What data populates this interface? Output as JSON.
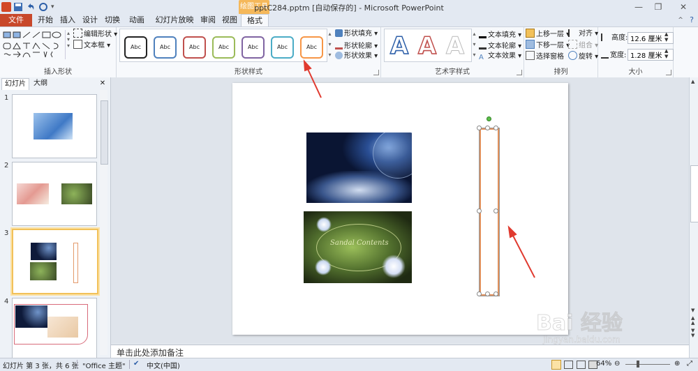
{
  "window": {
    "title": "pptC284.pptm [自动保存的] - Microsoft PowerPoint",
    "context_tab": "绘图工具"
  },
  "tabs": [
    "文件",
    "开始",
    "插入",
    "设计",
    "切换",
    "动画",
    "幻灯片放映",
    "审阅",
    "视图",
    "格式"
  ],
  "ribbon": {
    "insert_shapes": {
      "edit_shape": "编辑形状",
      "text_box": "文本框",
      "label": "插入形状"
    },
    "shape_styles": {
      "sample": "Abc",
      "fill": "形状填充",
      "outline": "形状轮廓",
      "effects": "形状效果",
      "label": "形状样式",
      "colors": [
        "#222222",
        "#4f81bd",
        "#c0504d",
        "#9bbb59",
        "#8064a2",
        "#4bacc6",
        "#f79646"
      ]
    },
    "wordart": {
      "letter": "A",
      "text_fill": "文本填充",
      "text_outline": "文本轮廓",
      "text_effects": "文本效果",
      "label": "艺术字样式"
    },
    "arrange": {
      "bring_forward": "上移一层",
      "send_backward": "下移一层",
      "selection_pane": "选择窗格",
      "align": "对齐",
      "group": "组合",
      "rotate": "旋转",
      "label": "排列"
    },
    "size": {
      "height_label": "高度:",
      "height_value": "12.6 厘米",
      "width_label": "宽度:",
      "width_value": "1.28 厘米",
      "label": "大小"
    }
  },
  "left_panel": {
    "tab_slides": "幻灯片",
    "tab_outline": "大纲",
    "slide_numbers": [
      "1",
      "2",
      "3",
      "4"
    ]
  },
  "slide": {
    "watermark_text": "Sandal Contents"
  },
  "notes": {
    "placeholder": "单击此处添加备注"
  },
  "status": {
    "slide_info": "幻灯片 第 3 张，共 6 张",
    "theme": "\"Office 主题\"",
    "language": "中文(中国)",
    "zoom": "64%"
  },
  "watermark": {
    "brand": "Bai  经验",
    "url": "jingyan.baidu.com"
  }
}
